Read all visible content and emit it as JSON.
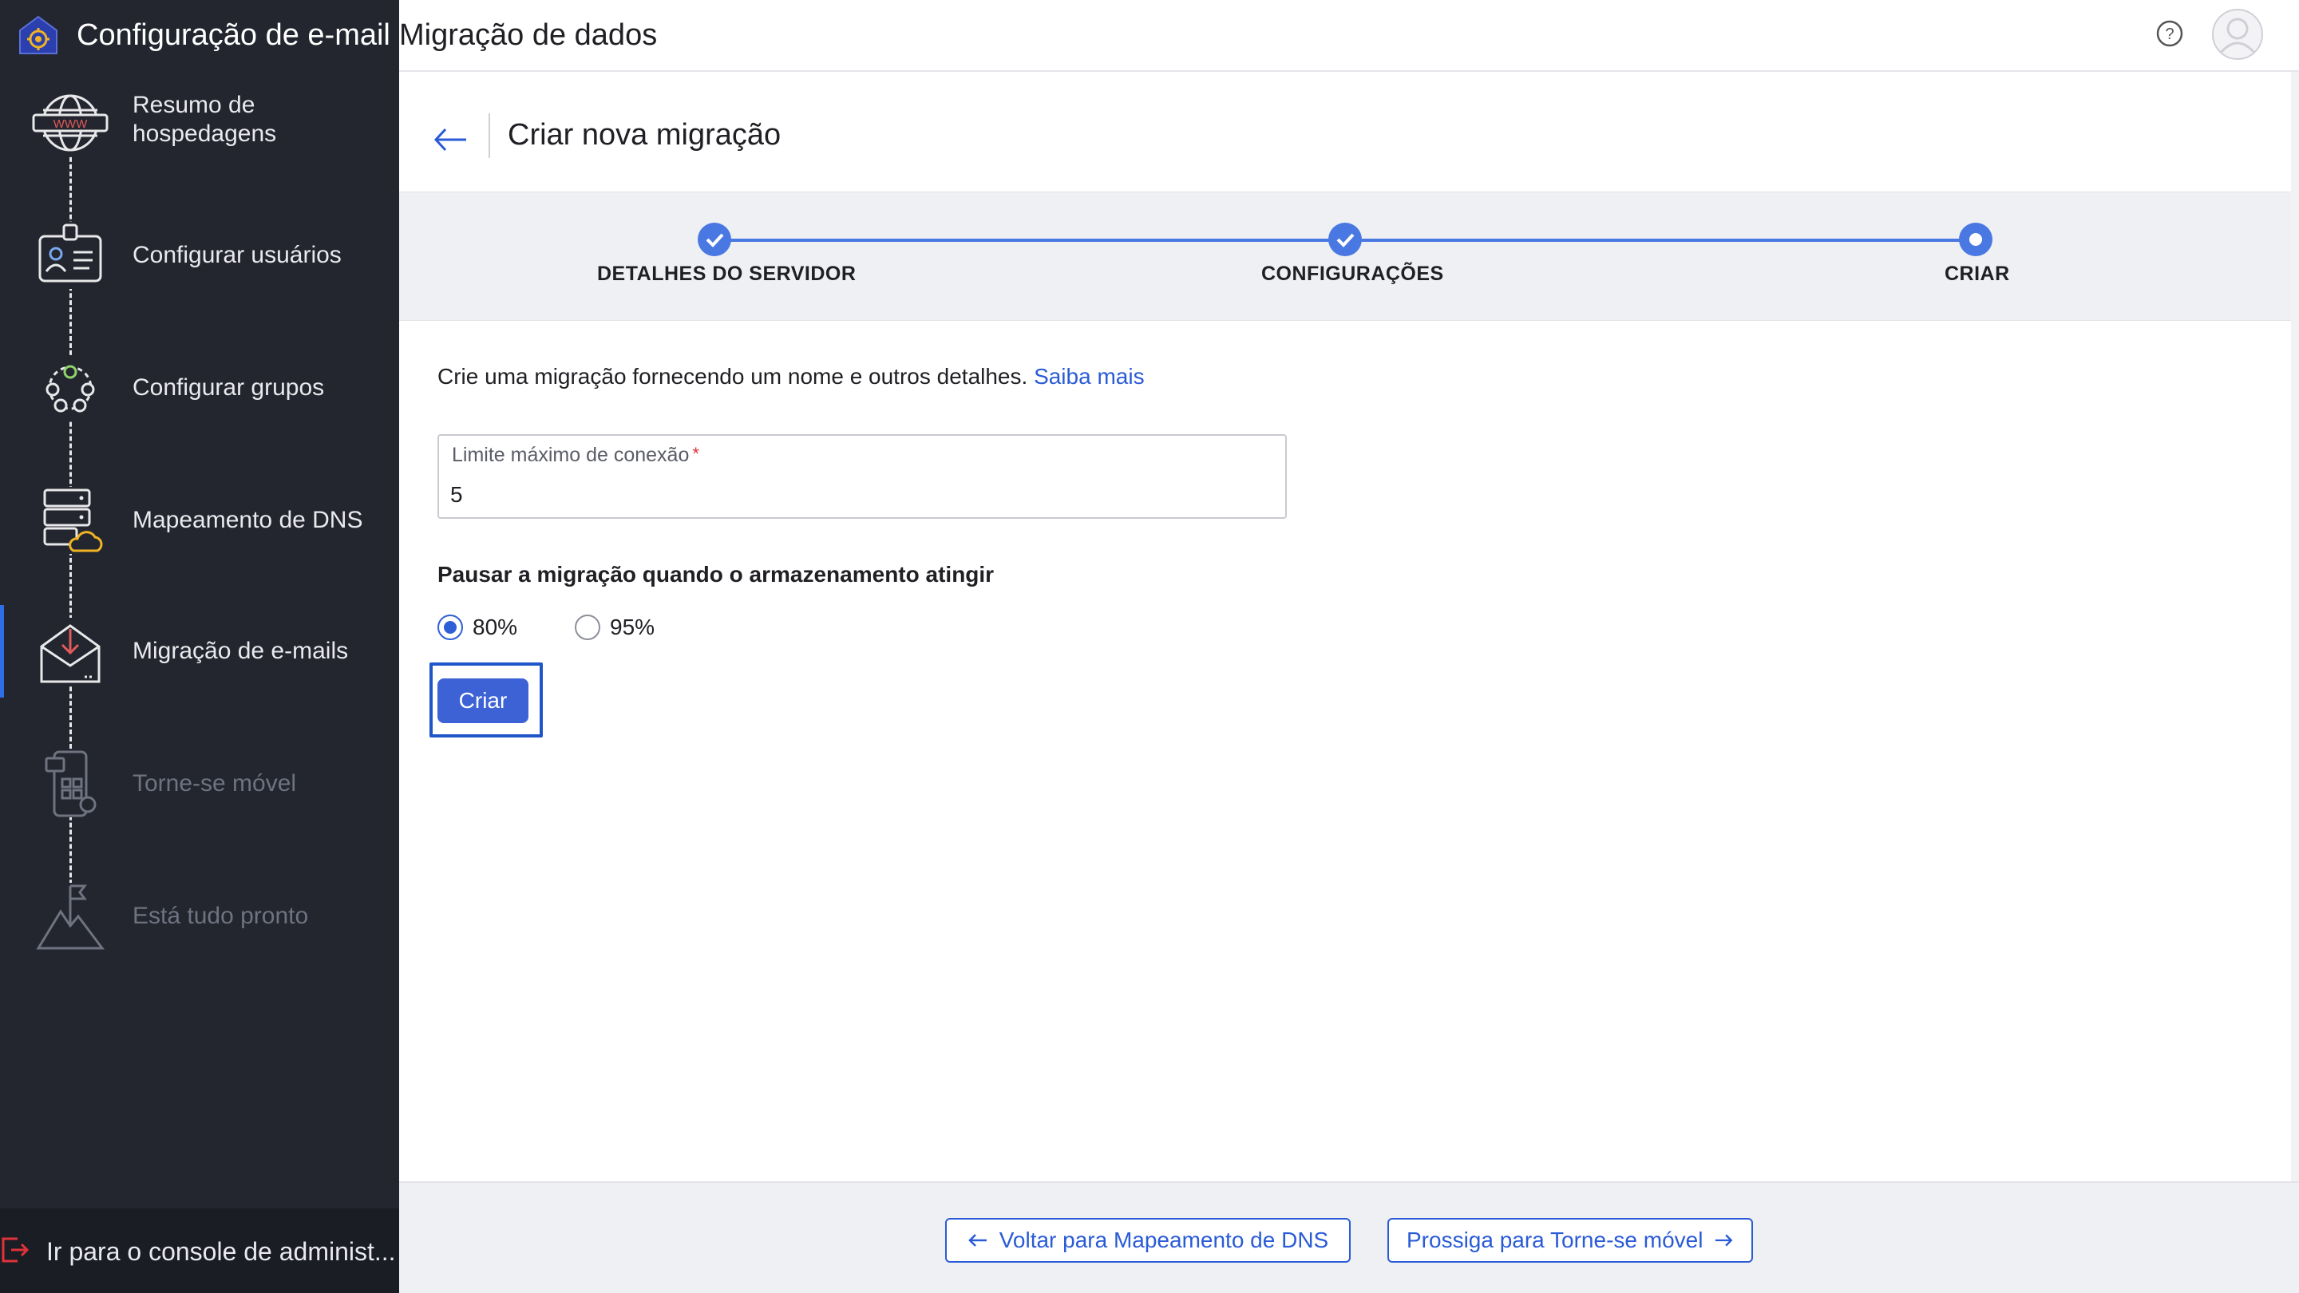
{
  "sidebar": {
    "title": "Configuração de e-mail",
    "items": [
      {
        "label": "Resumo de hospedagens",
        "icon": "globe-www-icon",
        "state": "done"
      },
      {
        "label": "Configurar usuários",
        "icon": "user-badge-icon",
        "state": "done"
      },
      {
        "label": "Configurar grupos",
        "icon": "group-network-icon",
        "state": "done"
      },
      {
        "label": "Mapeamento de DNS",
        "icon": "server-cloud-icon",
        "state": "done"
      },
      {
        "label": "Migração de e-mails",
        "icon": "mail-download-icon",
        "state": "active"
      },
      {
        "label": "Torne-se móvel",
        "icon": "mobile-icon",
        "state": "disabled"
      },
      {
        "label": "Está tudo pronto",
        "icon": "mountain-flag-icon",
        "state": "disabled"
      }
    ],
    "footer_label": "Ir para o console de administ..."
  },
  "header": {
    "title": "Migração de dados",
    "help_icon": "help-icon",
    "avatar_icon": "avatar-icon"
  },
  "page": {
    "heading": "Criar nova migração",
    "steps": [
      {
        "label": "DETALHES DO SERVIDOR",
        "status": "complete"
      },
      {
        "label": "CONFIGURAÇÕES",
        "status": "complete"
      },
      {
        "label": "CRIAR",
        "status": "current"
      }
    ],
    "description": "Crie uma migração fornecendo um nome e outros detalhes.",
    "learn_more": "Saiba mais",
    "field": {
      "label": "Limite máximo de conexão",
      "required_mark": "*",
      "value": "5"
    },
    "pause_title": "Pausar a migração quando o armazenamento atingir",
    "radio_options": [
      {
        "label": "80%",
        "checked": true
      },
      {
        "label": "95%",
        "checked": false
      }
    ],
    "create_button": "Criar"
  },
  "footer": {
    "back_button": "Voltar para Mapeamento de DNS",
    "next_button": "Prossiga para Torne-se móvel"
  },
  "colors": {
    "sidebar_bg": "#23262f",
    "accent": "#3c62d6",
    "link": "#2a5bd7",
    "stepper": "#4a78e2"
  }
}
